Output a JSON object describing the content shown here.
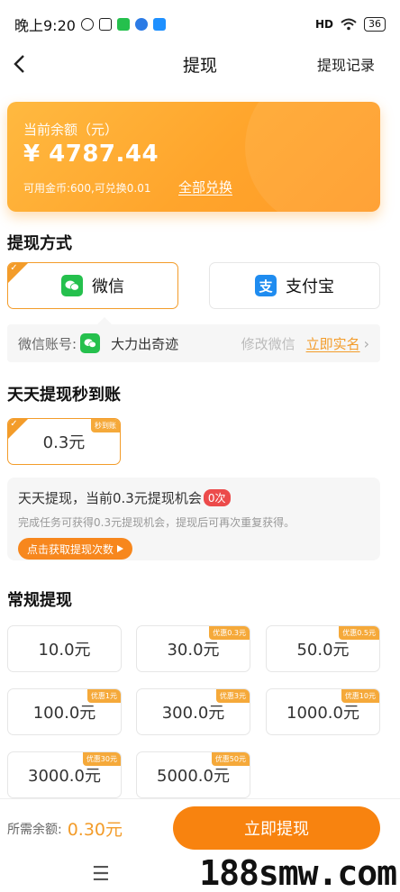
{
  "status_bar": {
    "time": "晚上9:20",
    "battery": "36",
    "signal": "HD"
  },
  "nav": {
    "title": "提现",
    "record": "提现记录"
  },
  "balance": {
    "label": "当前余额（元）",
    "amount": "¥ 4787.44",
    "coin_info": "可用金币:600,可兑换0.01",
    "exchange_all": "全部兑换"
  },
  "withdraw_method": {
    "title": "提现方式",
    "options": [
      {
        "label": "微信",
        "selected": true
      },
      {
        "label": "支付宝",
        "selected": false
      }
    ],
    "account": {
      "label": "微信账号:",
      "name": "大力出奇迹",
      "modify": "修改微信",
      "realname": "立即实名"
    }
  },
  "daily": {
    "title": "天天提现秒到账",
    "amount": "0.3元",
    "tag": "秒到账",
    "info_line": "天天提现，当前0.3元提现机会",
    "chance": "0次",
    "desc": "完成任务可获得0.3元提现机会，提现后可再次重复获得。",
    "get_button": "点击获取提现次数"
  },
  "regular": {
    "title": "常规提现",
    "amounts": [
      {
        "value": "10.0元",
        "tag": ""
      },
      {
        "value": "30.0元",
        "tag": "优惠0.3元"
      },
      {
        "value": "50.0元",
        "tag": "优惠0.5元"
      },
      {
        "value": "100.0元",
        "tag": "优惠1元"
      },
      {
        "value": "300.0元",
        "tag": "优惠3元"
      },
      {
        "value": "1000.0元",
        "tag": "优惠10元"
      },
      {
        "value": "3000.0元",
        "tag": "优惠30元"
      },
      {
        "value": "5000.0元",
        "tag": "优惠50元"
      }
    ]
  },
  "footer": {
    "need_label": "所需余额:",
    "need_amount": "0.30元",
    "submit": "立即提现"
  },
  "system_nav": {
    "menu_glyph": "☰"
  },
  "watermark": "188smw.com",
  "colors": {
    "accent": "#f39c2a",
    "button": "#f8830f",
    "wechat": "#25c04d",
    "alipay": "#1f8cf0",
    "badge": "#ec4b4b"
  }
}
